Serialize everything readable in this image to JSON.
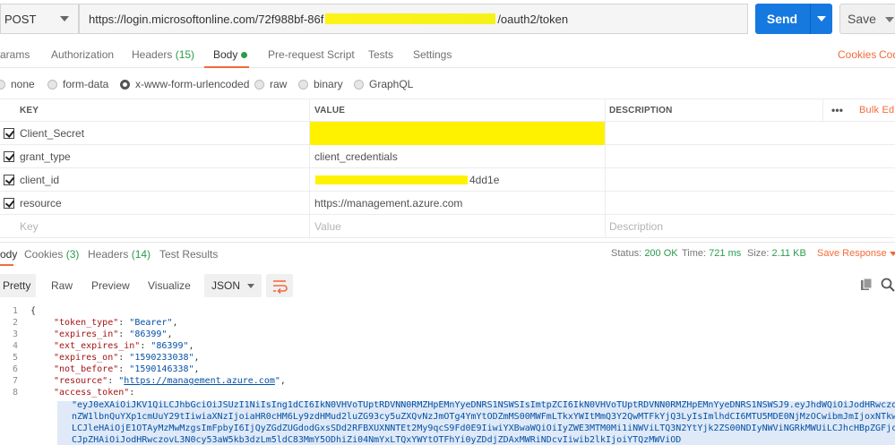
{
  "request": {
    "method": "POST",
    "url_prefix": "https://login.microsoftonline.com/72f988bf-86f",
    "url_suffix": "/oauth2/token",
    "send_label": "Send",
    "save_label": "Save"
  },
  "request_tabs": {
    "params": "arams",
    "authorization": "Authorization",
    "headers": "Headers",
    "headers_count": "(15)",
    "body": "Body",
    "pre_request": "Pre-request Script",
    "tests": "Tests",
    "settings": "Settings",
    "cookies": "Cookies",
    "code": "Cod"
  },
  "body_types": {
    "none": "none",
    "form_data": "form-data",
    "urlencoded": "x-www-form-urlencoded",
    "raw": "raw",
    "binary": "binary",
    "graphql": "GraphQL"
  },
  "table": {
    "headers": {
      "key": "KEY",
      "value": "VALUE",
      "description": "DESCRIPTION",
      "more": "•••",
      "bulk_edit": "Bulk Edit"
    },
    "rows": [
      {
        "key": "Client_Secret",
        "value": ""
      },
      {
        "key": "grant_type",
        "value": "client_credentials"
      },
      {
        "key": "client_id",
        "value": "4dd1e"
      },
      {
        "key": "resource",
        "value": "https://management.azure.com"
      }
    ],
    "placeholder": {
      "key": "Key",
      "value": "Value",
      "description": "Description"
    }
  },
  "response_tabs": {
    "body": "ody",
    "cookies": "Cookies",
    "cookies_count": "(3)",
    "headers": "Headers",
    "headers_count": "(14)",
    "test_results": "Test Results",
    "status_label": "Status:",
    "status_value": "200 OK",
    "time_label": "Time:",
    "time_value": "721 ms",
    "size_label": "Size:",
    "size_value": "2.11 KB",
    "save_response": "Save Response"
  },
  "response_toolbar": {
    "pretty": "Pretty",
    "raw": "Raw",
    "preview": "Preview",
    "visualize": "Visualize",
    "format": "JSON"
  },
  "json_lines": [
    {
      "n": "1",
      "text": "{"
    },
    {
      "n": "2",
      "key": "\"token_type\"",
      "val": "\"Bearer\""
    },
    {
      "n": "3",
      "key": "\"expires_in\"",
      "val": "\"86399\""
    },
    {
      "n": "4",
      "key": "\"ext_expires_in\"",
      "val": "\"86399\""
    },
    {
      "n": "5",
      "key": "\"expires_on\"",
      "val": "\"1590233038\""
    },
    {
      "n": "6",
      "key": "\"not_before\"",
      "val": "\"1590146338\""
    },
    {
      "n": "7",
      "key": "\"resource\"",
      "val": "https://management.azure.com"
    },
    {
      "n": "8",
      "key": "\"access_token\"",
      "val": ""
    }
  ],
  "token_lines": [
    "\"eyJ0eXAiOiJKV1QiLCJhbGciOiJSUzI1NiIsIng1dCI6IkN0VHVoTUptRDVNN0RMZHpEMnYyeDNRS1NSWSIsImtpZCI6IkN0VHVoTUptRDVNN0RMZHpEMnYyeDNRS1NSWSJ9.eyJhdWQiOiJodHRwczovL21hbmF",
    "nZW1lbnQuYXp1cmUuY29tIiwiaXNzIjoiaHR0cHM6Ly9zdHMud2luZG93cy5uZXQvNzJmOTg4YmYtODZmMS00MWFmLTkxYWItMmQ3Y2QwMTFkYjQ3LyIsImlhdCI6MTU5MDE0NjMzOCwibmJmIjoxNTkwMTQ2MzM4",
    "LCJleHAiOjE1OTAyMzMwMzgsImFpbyI6IjQyZGdZUGdodGxsSDd2RFBXUXNNTEt2My9qcS9Fd0E9IiwiYXBwaWQiOiIyZWE3MTM0Mi1iNWViLTQ3N2YtYjk2ZS00NDIyNWViNGRkMWUiLCJhcHBpZGFjciI6IjEiL",
    "CJpZHAiOiJodHRwczovL3N0cy53aW5kb3dzLm5ldC83MmY5ODhiZi04NmYxLTQxYWYtOTFhYi0yZDdjZDAxMWRiNDcvIiwib2lkIjoiYTQzMWViOD"
  ]
}
